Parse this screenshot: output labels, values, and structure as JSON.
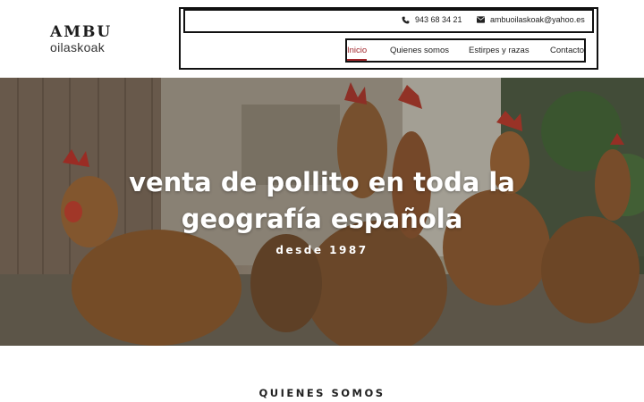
{
  "brand": {
    "logo_top": "AMBU",
    "logo_bottom": "oilaskoak"
  },
  "contact": {
    "phone": "943 68 34 21",
    "email": "ambuoilaskoak@yahoo.es"
  },
  "nav": {
    "items": [
      {
        "label": "Inicio",
        "active": true
      },
      {
        "label": "Quienes somos",
        "active": false
      },
      {
        "label": "Estirpes y razas",
        "active": false
      },
      {
        "label": "Contacto",
        "active": false
      }
    ]
  },
  "hero": {
    "title": "venta de pollito en toda la geografía española",
    "subtitle": "desde 1987"
  },
  "section": {
    "title": "QUIENES SOMOS"
  },
  "colors": {
    "accent": "#a0252a",
    "text": "#222222",
    "background": "#ffffff"
  },
  "icons": {
    "phone": "phone-icon",
    "email": "envelope-icon"
  }
}
